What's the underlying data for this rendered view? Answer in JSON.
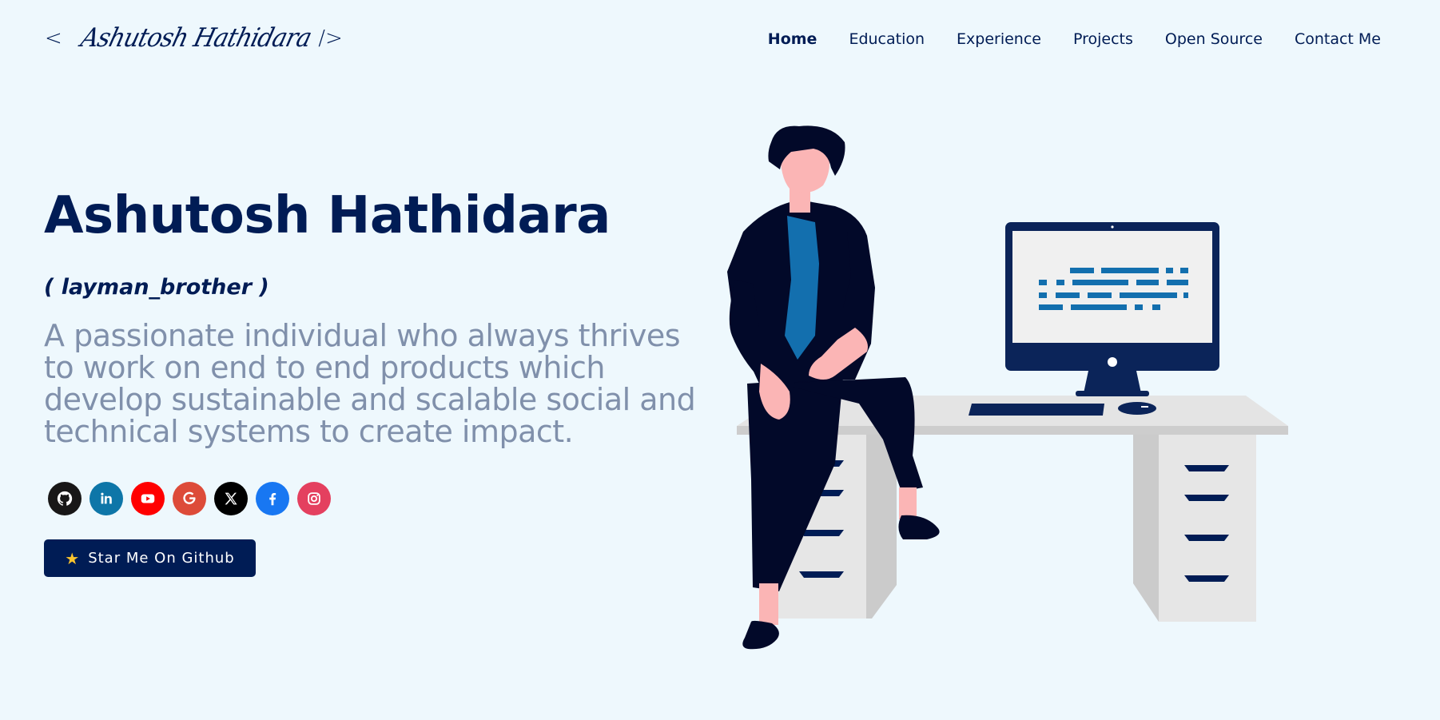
{
  "header": {
    "logo_open": "<",
    "logo_name": "Ashutosh Hathidara",
    "logo_close": "/>",
    "nav": [
      {
        "label": "Home",
        "active": true
      },
      {
        "label": "Education",
        "active": false
      },
      {
        "label": "Experience",
        "active": false
      },
      {
        "label": "Projects",
        "active": false
      },
      {
        "label": "Open Source",
        "active": false
      },
      {
        "label": "Contact Me",
        "active": false
      }
    ]
  },
  "hero": {
    "name": "Ashutosh Hathidara",
    "nickname": "( layman_brother )",
    "tagline": "A passionate individual who always thrives to work on end to end products which develop sustainable and scalable social and technical systems to create impact."
  },
  "social": [
    {
      "icon": "github-icon",
      "color": "#181717"
    },
    {
      "icon": "linkedin-icon",
      "color": "#0e76a8"
    },
    {
      "icon": "youtube-icon",
      "color": "#ff0000"
    },
    {
      "icon": "google-icon",
      "color": "#dd4b39"
    },
    {
      "icon": "x-icon",
      "color": "#000000"
    },
    {
      "icon": "facebook-icon",
      "color": "#1877f2"
    },
    {
      "icon": "instagram-icon",
      "color": "#e4405f"
    }
  ],
  "cta": {
    "icon": "star-icon",
    "label": "Star Me On Github"
  },
  "colors": {
    "background": "#eef8fd",
    "primary": "#001c55",
    "tagline": "#8090ab",
    "accent_blue": "#136fae"
  }
}
